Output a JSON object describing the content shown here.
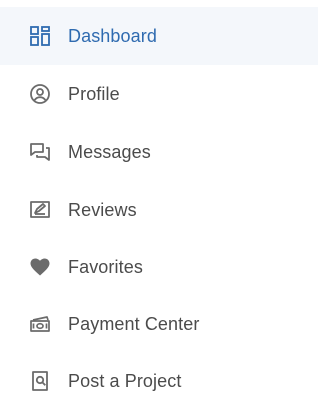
{
  "sidebar": {
    "active_index": 0,
    "colors": {
      "active_text": "#2f6bb0",
      "active_background": "#f4f7fb",
      "text": "#4b4b4b",
      "icon": "#6b6b6b"
    },
    "items": [
      {
        "label": "Dashboard",
        "icon": "dashboard-grid-icon"
      },
      {
        "label": "Profile",
        "icon": "user-circle-icon"
      },
      {
        "label": "Messages",
        "icon": "chat-bubbles-icon"
      },
      {
        "label": "Reviews",
        "icon": "review-card-icon"
      },
      {
        "label": "Favorites",
        "icon": "heart-icon"
      },
      {
        "label": "Payment Center",
        "icon": "cash-icon"
      },
      {
        "label": "Post a Project",
        "icon": "document-search-icon"
      }
    ]
  }
}
